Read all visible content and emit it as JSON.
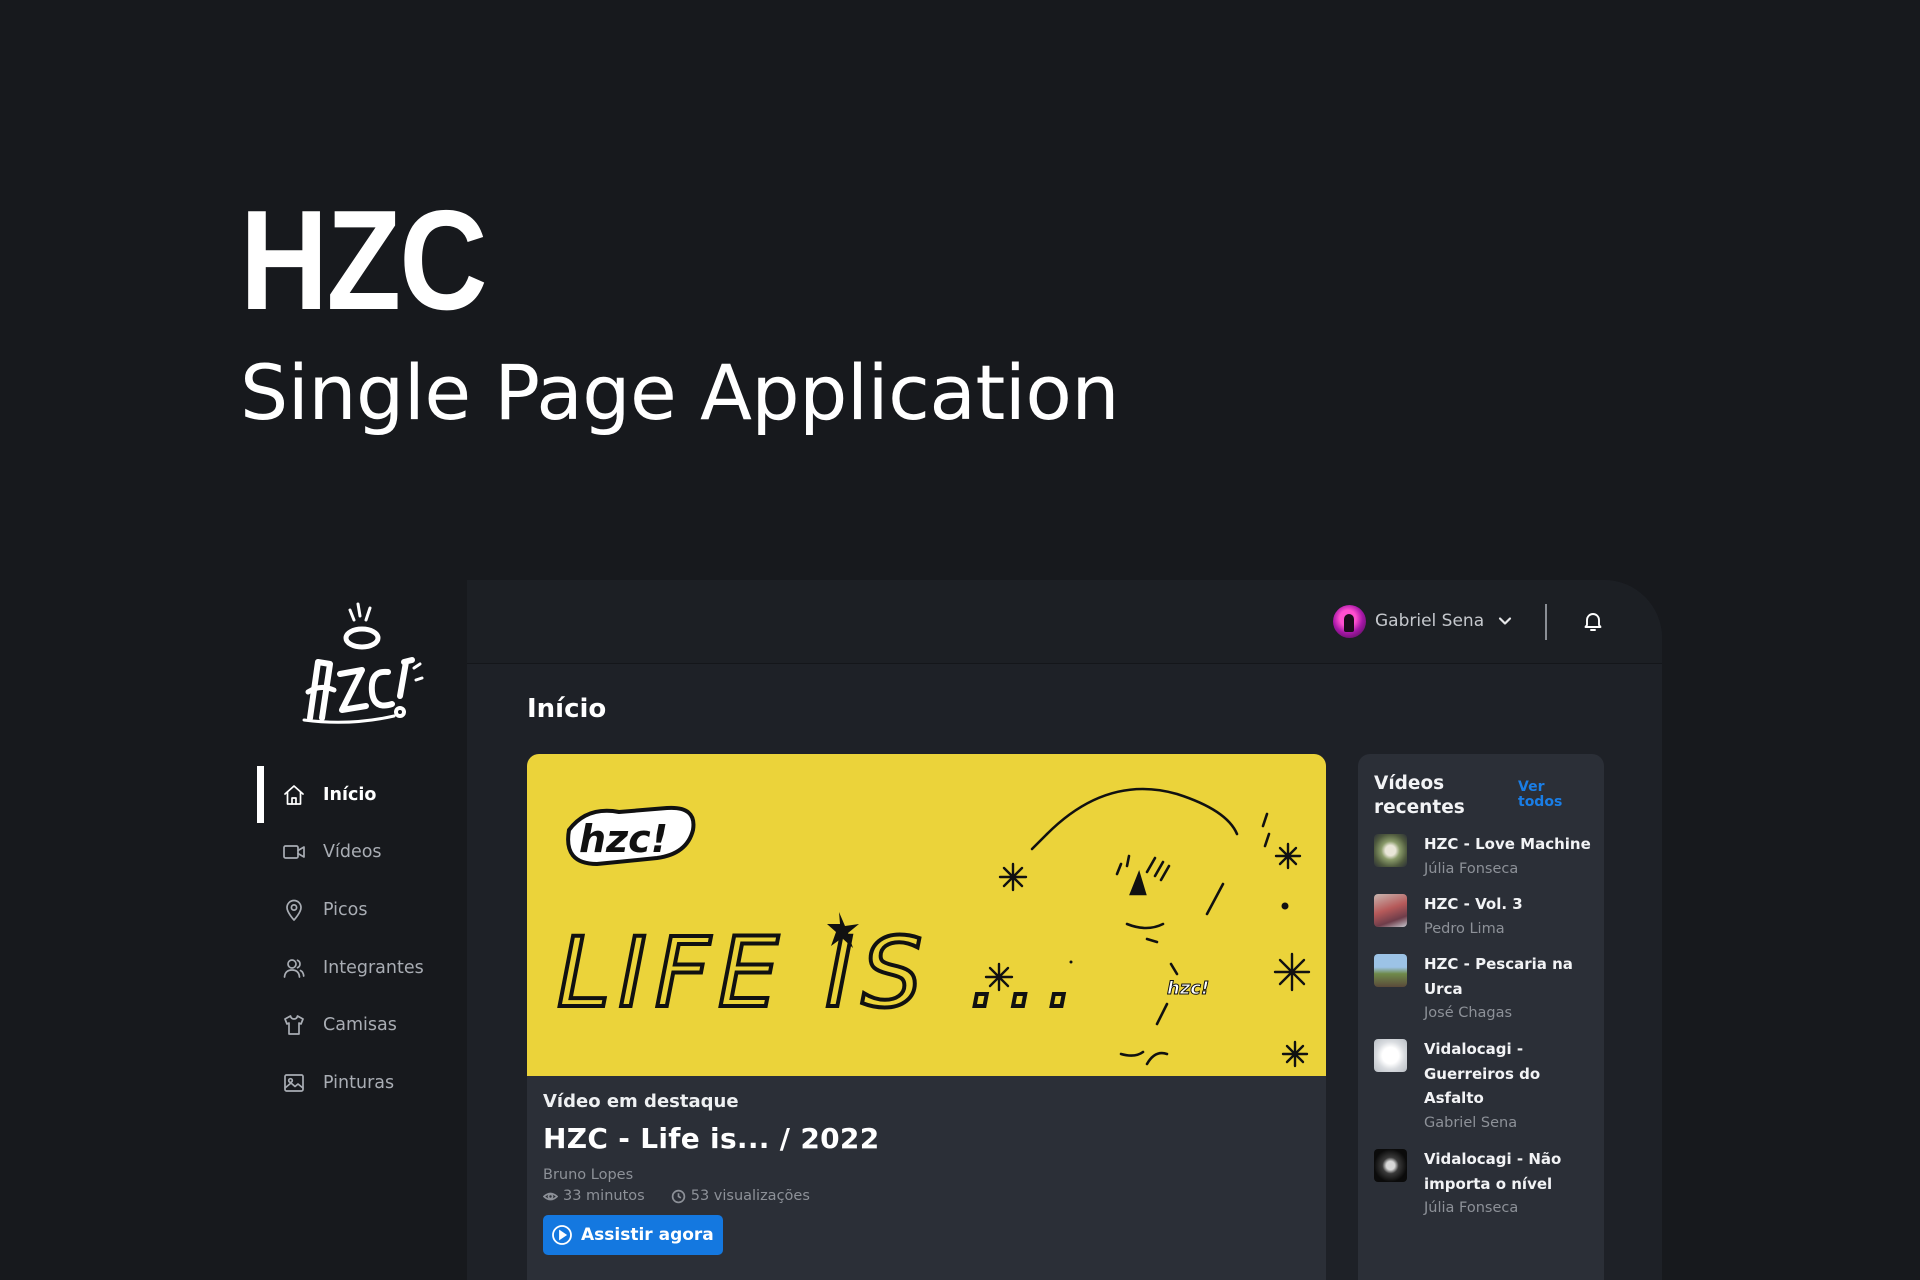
{
  "hero": {
    "title": "HZC",
    "subtitle": "Single Page Application"
  },
  "sidebar": {
    "logo_alt": "hzc!",
    "items": [
      {
        "label": "Início",
        "icon": "home-icon",
        "active": true
      },
      {
        "label": "Vídeos",
        "icon": "video-camera-icon",
        "active": false
      },
      {
        "label": "Picos",
        "icon": "map-pin-icon",
        "active": false
      },
      {
        "label": "Integrantes",
        "icon": "users-icon",
        "active": false
      },
      {
        "label": "Camisas",
        "icon": "shirt-icon",
        "active": false
      },
      {
        "label": "Pinturas",
        "icon": "image-icon",
        "active": false
      }
    ]
  },
  "header": {
    "user_name": "Gabriel Sena",
    "notifications_icon": "bell-icon"
  },
  "main": {
    "title": "Início",
    "featured": {
      "label": "Vídeo em destaque",
      "title": "HZC - Life is... / 2022",
      "author": "Bruno Lopes",
      "duration": "33 minutos",
      "views": "53 visualizações",
      "button_label": "Assistir agora",
      "thumbnail_text": "LIFE IS ..."
    },
    "recent": {
      "heading": "Vídeos recentes",
      "see_all": "Ver todos",
      "items": [
        {
          "title": "HZC - Love Machine",
          "author": "Júlia Fonseca"
        },
        {
          "title": "HZC - Vol. 3",
          "author": "Pedro Lima"
        },
        {
          "title": "HZC - Pescaria na Urca",
          "author": "José Chagas"
        },
        {
          "title": "Vidalocagi - Guerreiros do Asfalto",
          "author": "Gabriel Sena"
        },
        {
          "title": "Vidalocagi - Não importa o nível",
          "author": "Júlia Fonseca"
        }
      ]
    }
  },
  "colors": {
    "background": "#17191d",
    "panel": "#1e2127",
    "card": "#2b2f37",
    "accent": "#1478e0",
    "thumbnail_yellow": "#ebd33a"
  }
}
